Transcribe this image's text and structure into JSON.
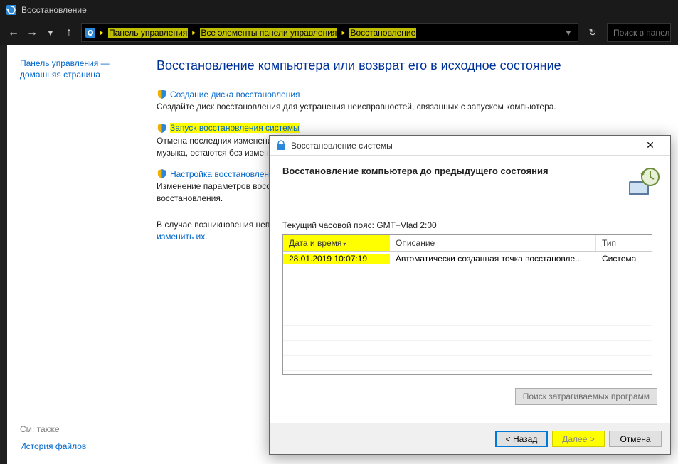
{
  "titlebar": {
    "title": "Восстановление"
  },
  "nav": {
    "breadcrumb": [
      "Панель управления",
      "Все элементы панели управления",
      "Восстановление"
    ],
    "search_placeholder": "Поиск в панели"
  },
  "sidepane": {
    "home": "Панель управления — домашняя страница",
    "see_also": "См. также",
    "history": "История файлов"
  },
  "main": {
    "heading": "Восстановление компьютера или возврат его в исходное состояние",
    "options": [
      {
        "link": "Создание диска восстановления",
        "desc": "Создайте диск восстановления для устранения неисправностей, связанных с запуском компьютера.",
        "hl": false
      },
      {
        "link": "Запуск восстановления системы",
        "desc": "Отмена последних изменений системы, которые могли вызвать проблемы. Ваши файлы, например документы, изображения и музыка, остаются без изменений.",
        "hl": true
      },
      {
        "link": "Настройка восстановления системы",
        "desc": "Изменение параметров восстановления, управление дисковым пространством и создание или удаление точек восстановления.",
        "hl": false
      }
    ],
    "note_prefix": "В случае возникновения неполадок с компьютером ",
    "note_link": "изменить их."
  },
  "dialog": {
    "title": "Восстановление системы",
    "subtitle": "Восстановление компьютера до предыдущего состояния",
    "timezone": "Текущий часовой пояс: GMT+Vlad 2:00",
    "columns": {
      "dt": "Дата и время",
      "desc": "Описание",
      "type": "Тип"
    },
    "rows": [
      {
        "dt": "28.01.2019 10:07:19",
        "desc": "Автоматически созданная точка восстановле...",
        "type": "Система"
      }
    ],
    "affected_btn": "Поиск затрагиваемых программ",
    "buttons": {
      "back": "< Назад",
      "next": "Далее >",
      "cancel": "Отмена"
    }
  }
}
